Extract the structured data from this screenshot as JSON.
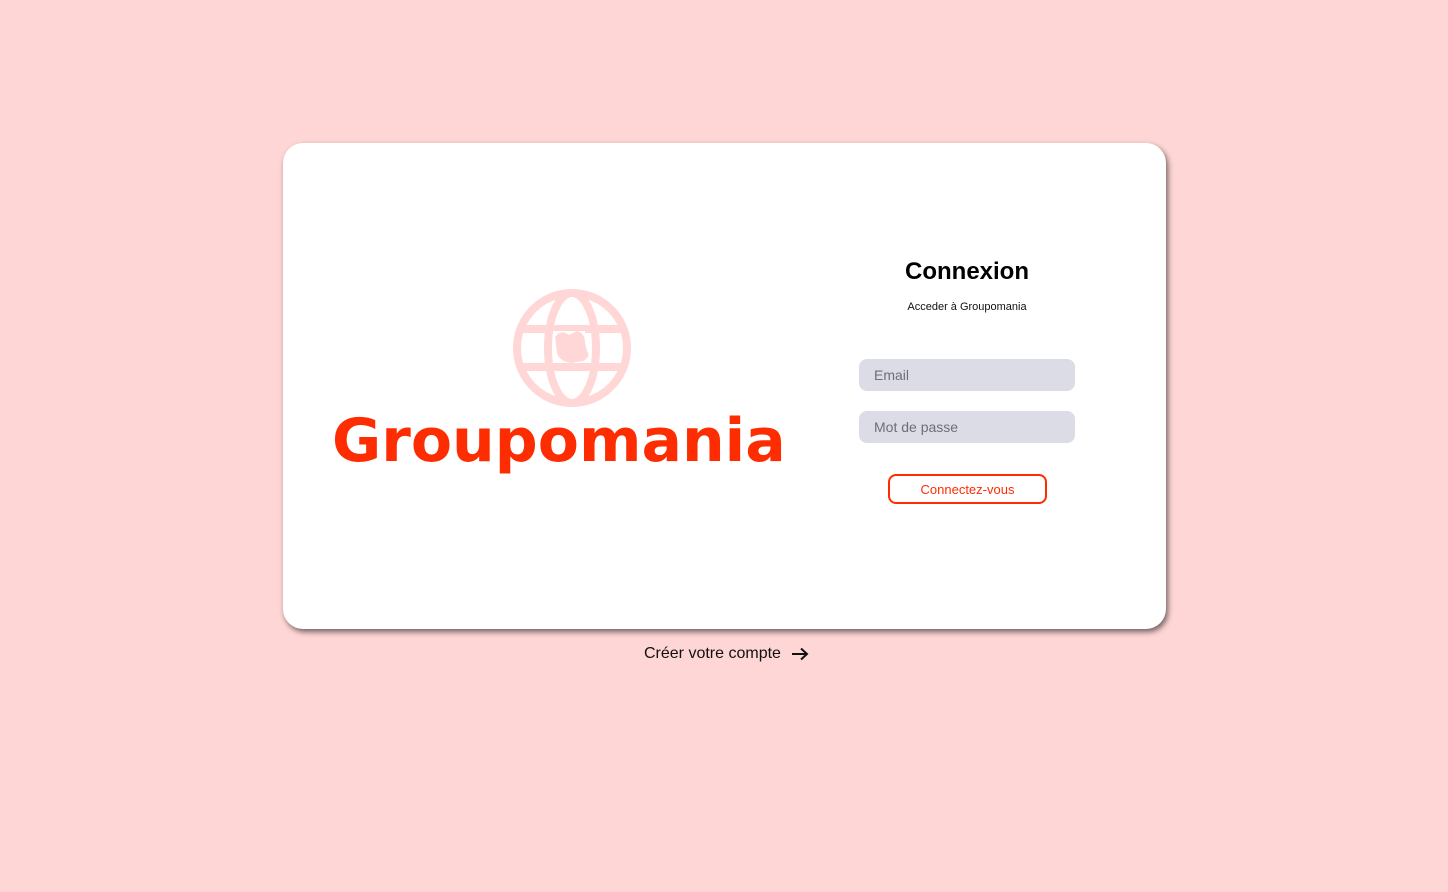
{
  "brand": {
    "name": "Groupomania",
    "primary_color": "#fd2d01",
    "secondary_color": "#ffd7d7",
    "logo_icon": "globe-icon"
  },
  "login": {
    "title": "Connexion",
    "subtitle": "Acceder à Groupomania",
    "email_placeholder": "Email",
    "password_placeholder": "Mot de passe",
    "submit_label": "Connectez-vous"
  },
  "signup": {
    "link_label": "Créer votre compte",
    "icon": "arrow-right-icon"
  }
}
